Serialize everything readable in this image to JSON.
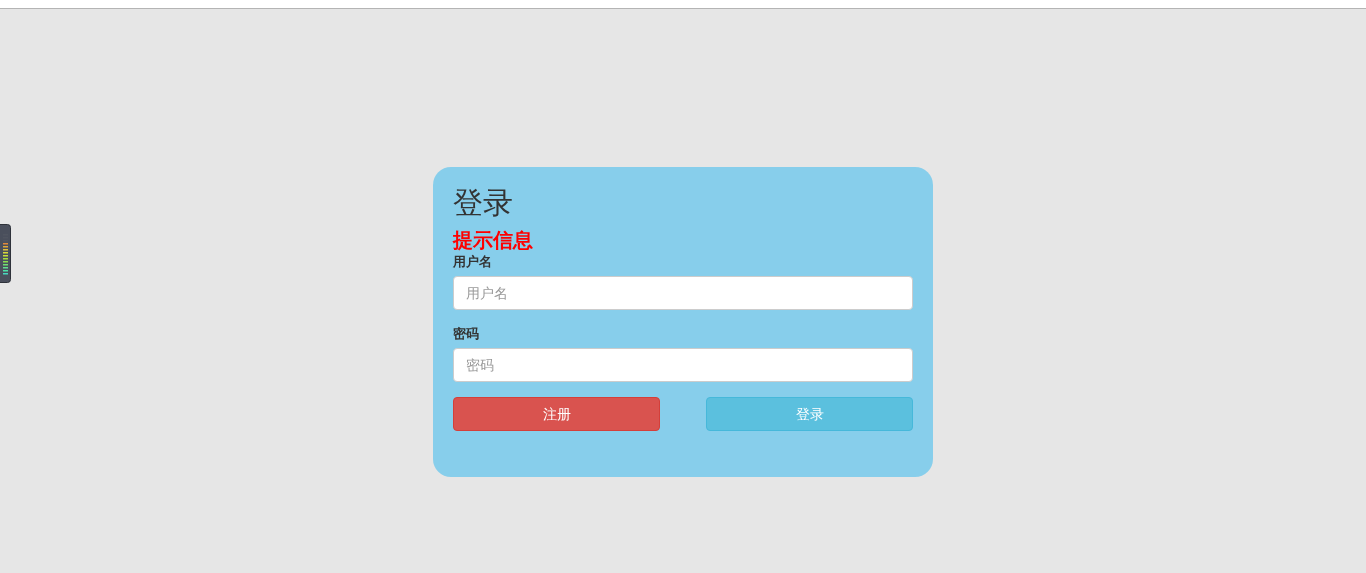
{
  "login_form": {
    "title": "登录",
    "message": "提示信息",
    "fields": [
      {
        "label": "用户名",
        "placeholder": "用户名"
      },
      {
        "label": "密码",
        "placeholder": "密码"
      }
    ],
    "buttons": [
      {
        "label": "注册",
        "kind": "danger"
      },
      {
        "label": "登录",
        "kind": "info"
      }
    ]
  }
}
